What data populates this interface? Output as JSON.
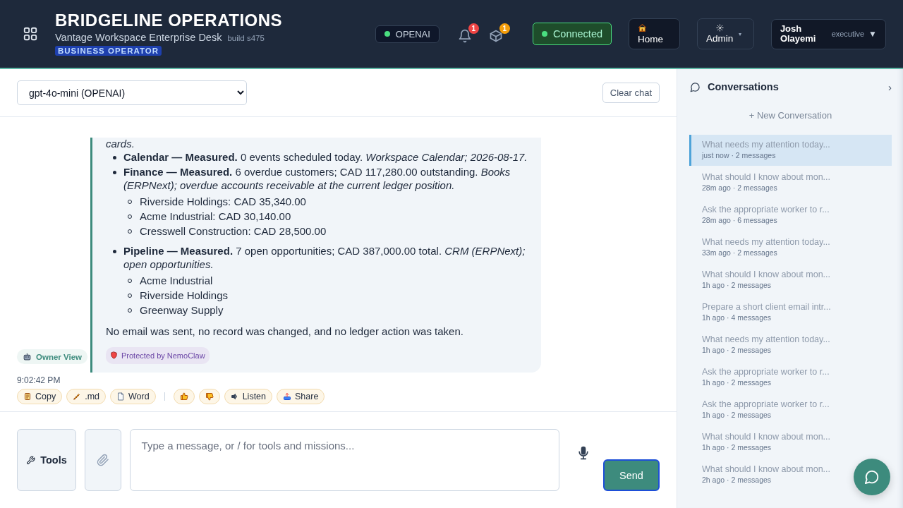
{
  "header": {
    "title": "BRIDGELINE OPERATIONS",
    "subtitle": "Vantage Workspace Enterprise Desk",
    "build": "build s475",
    "role": "BUSINESS OPERATOR",
    "provider": {
      "label": "OPENAI",
      "online": true
    },
    "alerts": [
      {
        "kind": "bell",
        "count": "1",
        "color": "#ef4444"
      },
      {
        "kind": "box",
        "count": "1",
        "color": "#f59e0b"
      }
    ],
    "connection": {
      "label": "Connected",
      "connected": true
    },
    "home": {
      "label": "Home"
    },
    "admin": {
      "label": "Admin",
      "caret": "▾"
    },
    "user": {
      "name": "Josh Olayemi",
      "role": "executive",
      "caret": "▼"
    }
  },
  "model_bar": {
    "model": "gpt-4o-mini (OPENAI)",
    "clear": "Clear chat"
  },
  "message": {
    "sender": "Owner View",
    "lead": "cards.",
    "items": [
      {
        "text": "**Calendar — Measured.** 0 events scheduled today. *Workspace Calendar; 2026-08-17.*"
      },
      {
        "text": "**Finance — Measured.** 6 overdue customers; CAD 117,280.00 outstanding. *Books (ERPNext); overdue accounts receivable at the current ledger position.*",
        "children": [
          "Riverside Holdings: CAD 35,340.00",
          "Acme Industrial: CAD 30,140.00",
          "Cresswell Construction: CAD 28,500.00"
        ]
      },
      {
        "text": "**Pipeline — Measured.** 7 open opportunities; CAD 387,000.00 total. *CRM (ERPNext); open opportunities.*",
        "children": [
          "Acme Industrial",
          "Riverside Holdings",
          "Greenway Supply"
        ]
      }
    ],
    "closing": "No email was sent, no record was changed, and no ledger action was taken.",
    "badge": "Protected by NemoClaw",
    "time": "9:02:42 PM",
    "action_groups": [
      [
        {
          "kind": "copy",
          "label": "Copy"
        },
        {
          "kind": "markdown",
          "label": ".md"
        },
        {
          "kind": "word",
          "label": "Word"
        }
      ],
      [
        {
          "kind": "like"
        },
        {
          "kind": "dislike"
        },
        {
          "kind": "listen",
          "label": "Listen"
        },
        {
          "kind": "share",
          "label": "Share"
        }
      ]
    ]
  },
  "composer": {
    "tools": "Tools",
    "placeholder": "Type a message, or / for tools and missions...",
    "send": "Send"
  },
  "sidebar": {
    "title": "Conversations",
    "toggle": "›",
    "new": "+ New Conversation",
    "items": [
      {
        "title": "What needs my attention today...",
        "meta": "just now · 2 messages",
        "selected": true
      },
      {
        "title": "What should I know about mon...",
        "meta": "28m ago · 2 messages",
        "selected": false
      },
      {
        "title": "Ask the appropriate worker to r...",
        "meta": "28m ago · 6 messages",
        "selected": false
      },
      {
        "title": "What needs my attention today...",
        "meta": "33m ago · 2 messages",
        "selected": false
      },
      {
        "title": "What should I know about mon...",
        "meta": "1h ago · 2 messages",
        "selected": false
      },
      {
        "title": "Prepare a short client email intr...",
        "meta": "1h ago · 4 messages",
        "selected": false
      },
      {
        "title": "What needs my attention today...",
        "meta": "1h ago · 2 messages",
        "selected": false
      },
      {
        "title": "Ask the appropriate worker to r...",
        "meta": "1h ago · 2 messages",
        "selected": false
      },
      {
        "title": "Ask the appropriate worker to r...",
        "meta": "1h ago · 2 messages",
        "selected": false
      },
      {
        "title": "What should I know about mon...",
        "meta": "1h ago · 2 messages",
        "selected": false
      },
      {
        "title": "What should I know about mon...",
        "meta": "2h ago · 2 messages",
        "selected": false
      }
    ]
  }
}
